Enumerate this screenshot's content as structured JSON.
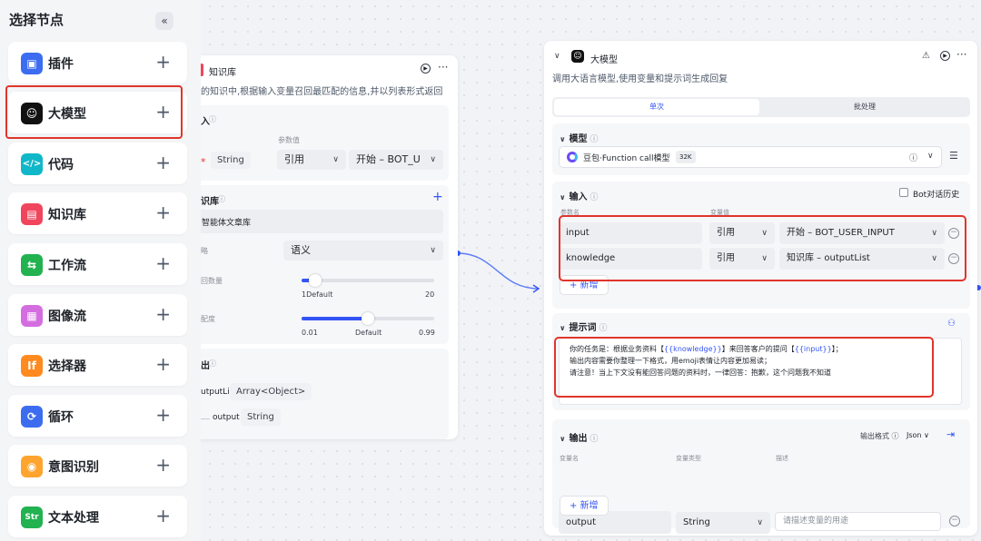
{
  "sidebar": {
    "title": "选择节点",
    "collapse_icon": "«",
    "items": [
      {
        "label": "插件",
        "icon": "plugin-icon",
        "color": "#3c6df0",
        "glyph": "▣"
      },
      {
        "label": "大模型",
        "icon": "llm-icon",
        "color": "#111111",
        "glyph": "☺"
      },
      {
        "label": "代码",
        "icon": "code-icon",
        "color": "#10b7c9",
        "glyph": "</>"
      },
      {
        "label": "知识库",
        "icon": "knowledge-icon",
        "color": "#f0455d",
        "glyph": "▤"
      },
      {
        "label": "工作流",
        "icon": "workflow-icon",
        "color": "#22b250",
        "glyph": "⇆"
      },
      {
        "label": "图像流",
        "icon": "imageflow-icon",
        "color": "#d46ee0",
        "glyph": "▦"
      },
      {
        "label": "选择器",
        "icon": "selector-icon",
        "color": "#ff8a1f",
        "glyph": "If"
      },
      {
        "label": "循环",
        "icon": "loop-icon",
        "color": "#3c6df0",
        "glyph": "⟳"
      },
      {
        "label": "意图识别",
        "icon": "intent-icon",
        "color": "#ffa42e",
        "glyph": "◉"
      },
      {
        "label": "文本处理",
        "icon": "text-process-icon",
        "color": "#22b250",
        "glyph": "Str"
      }
    ]
  },
  "knowledge_card": {
    "title": "知识库",
    "description": "的知识中,根据输入变量召回最匹配的信息,并以列表形式返回",
    "input_section": "入",
    "param_value_header": "参数值",
    "required_mark": "*",
    "input_type": "String",
    "ref_mode": "引用",
    "ref_value": "开始 – BOT_U",
    "kb_section": "识库",
    "kb_item": "智能体文章库",
    "search_label": "略",
    "search_value": "语义",
    "count_label": "回数量",
    "count_min": "1",
    "count_default": "Default",
    "count_max": "20",
    "count_value": 1,
    "score_label": "配度",
    "score_min": "0.01",
    "score_default": "Default",
    "score_max": "0.99",
    "score_value": 0.5,
    "output_section": "出",
    "output_name": "utputList",
    "output_type": "Array<Object>",
    "output_child": "output",
    "output_child_type": "String"
  },
  "llm_card": {
    "title": "大模型",
    "description": "调用大语言模型,使用变量和提示词生成回复",
    "tabs": [
      "单次",
      "批处理"
    ],
    "model_section": "模型",
    "model_name": "豆包·Function call模型",
    "model_badge": "32K",
    "input_section": "输入",
    "bot_history": "Bot对话历史",
    "param_name_header": "参数名",
    "var_value_header": "变量值",
    "inputs": [
      {
        "name": "input",
        "mode": "引用",
        "value": "开始 – BOT_USER_INPUT"
      },
      {
        "name": "knowledge",
        "mode": "引用",
        "value": "知识库 – outputList"
      }
    ],
    "add_label": "+ 新增",
    "prompt_section": "提示词",
    "prompt_line1_a": "你的任务是：根据业务资料【",
    "prompt_var1": "{{knowledge}}",
    "prompt_line1_b": "】来回答客户的提问【",
    "prompt_var2": "{{input}}",
    "prompt_line1_c": "】；",
    "prompt_line2": "输出内容需要你整理一下格式，用emoji表情让内容更加易读；",
    "prompt_line3": "请注意！当上下文没有能回答问题的资料时，一律回答：抱歉，这个问题我不知道",
    "output_section": "输出",
    "output_format_label": "输出格式",
    "output_format_value": "Json",
    "var_name_header": "变量名",
    "var_type_header": "变量类型",
    "desc_header": "描述",
    "output_name": "output",
    "output_type": "String",
    "output_desc_placeholder": "请描述变量的用途",
    "accent": "#3354f5",
    "highlight": "#e0352b"
  }
}
